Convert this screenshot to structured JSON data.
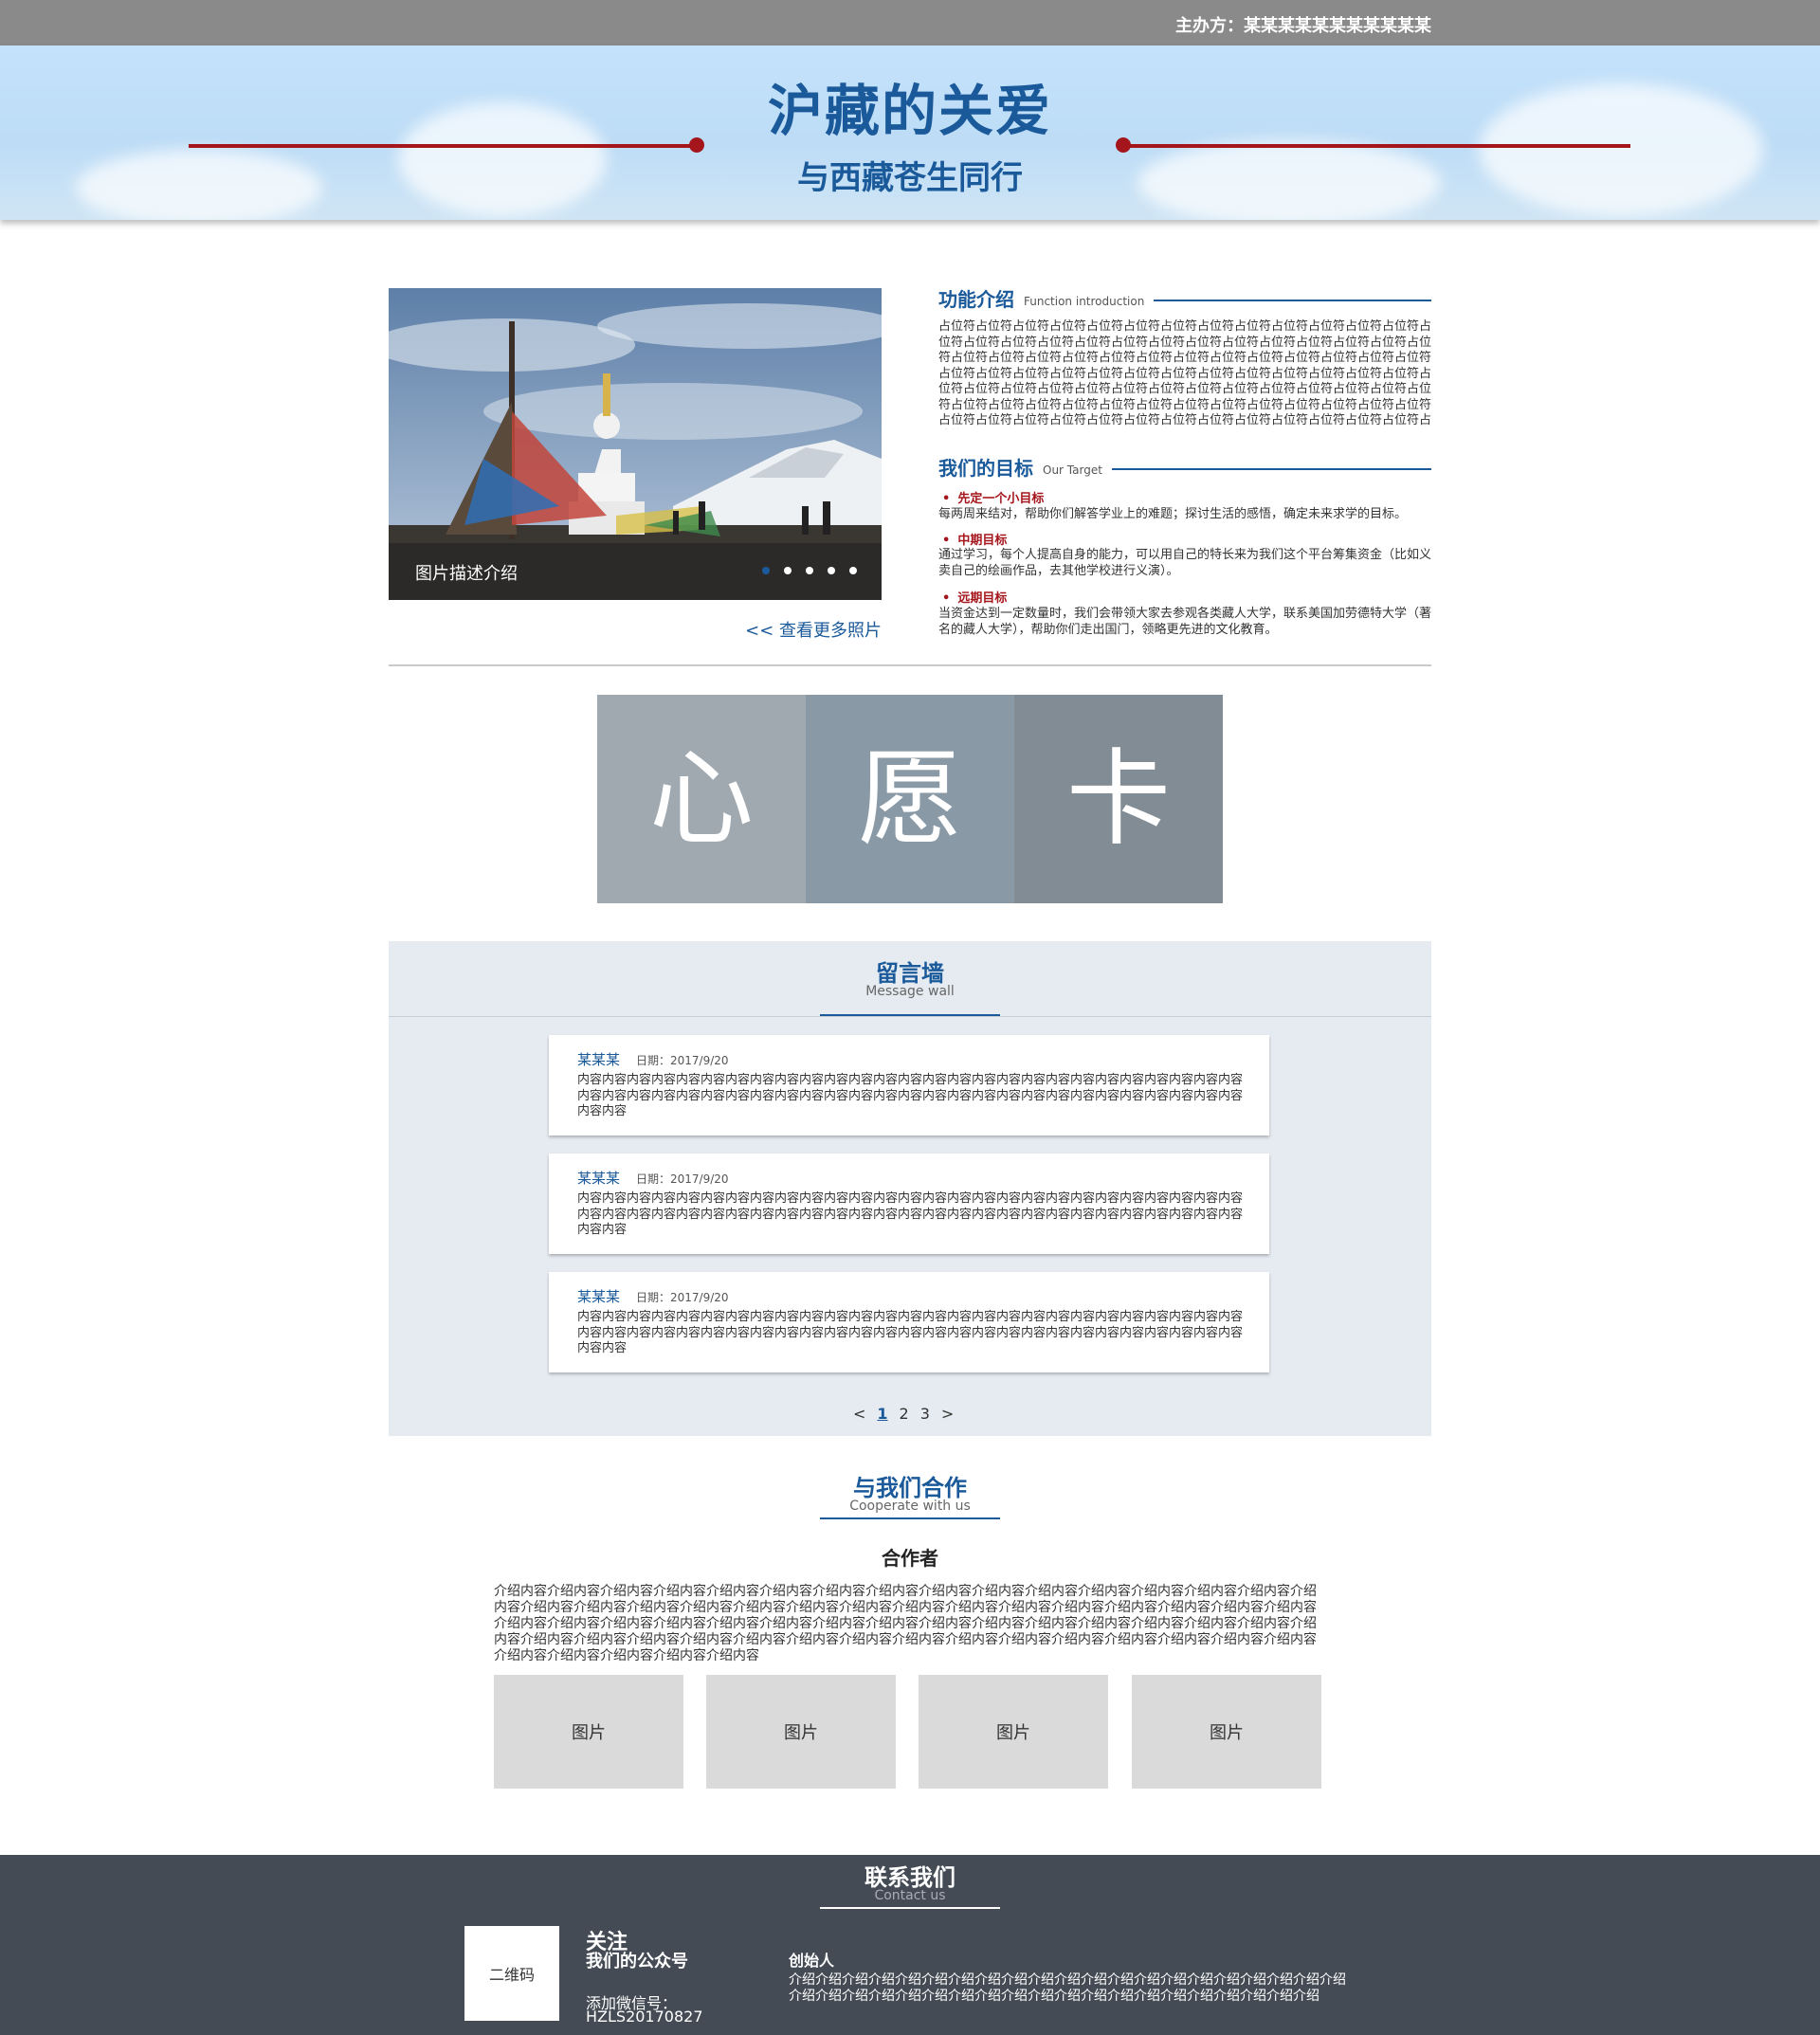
{
  "topbar": {
    "sponsor": "主办方：某某某某某某某某某某某"
  },
  "banner": {
    "title": "沪藏的关爱",
    "subtitle": "与西藏苍生同行"
  },
  "carousel": {
    "caption": "图片描述介绍",
    "more_link": "<< 查看更多照片",
    "slide_count": 5,
    "active_slide": 1
  },
  "function_intro": {
    "title": "功能介绍",
    "subtitle": "Function introduction",
    "body": "占位符占位符占位符占位符占位符占位符占位符占位符占位符占位符占位符占位符占位符占位符占位符占位符占位符占位符占位符占位符占位符占位符占位符占位符占位符占位符占位符占位符占位符占位符占位符占位符占位符占位符占位符占位符占位符占位符占位符占位符占位符占位符占位符占位符占位符占位符占位符占位符占位符占位符占位符占位符占位符占位符占位符占位符占位符占位符占位符占位符占位符占位符占位符占位符占位符占位符占位符占位符占位符占位符占位符占位符占位符占位符占位符占位符占位符占位符占位符占位符占位符占位符占位符占位符占位符占位符占位符占位符占位符占位符占位符占位符占位符占位符"
  },
  "goals": {
    "title": "我们的目标",
    "subtitle": "Our Target",
    "items": [
      {
        "title": "先定一个小目标",
        "body": "每两周来结对，帮助你们解答学业上的难题；探讨生活的感悟，确定未来求学的目标。"
      },
      {
        "title": "中期目标",
        "body": "通过学习，每个人提高自身的能力，可以用自己的特长来为我们这个平台筹集资金（比如义卖自己的绘画作品，去其他学校进行义演）。"
      },
      {
        "title": "远期目标",
        "body": "当资金达到一定数量时，我们会带领大家去参观各类藏人大学，联系美国加劳德特大学（著名的藏人大学），帮助你们走出国门，领略更先进的文化教育。"
      }
    ]
  },
  "wish_card": {
    "chars": [
      "心",
      "愿",
      "卡"
    ],
    "colors": [
      "#a1a9b0",
      "#8999a6",
      "#828c94"
    ]
  },
  "message_wall": {
    "title": "留言墙",
    "subtitle": "Message wall",
    "messages": [
      {
        "author": "某某某",
        "date": "日期：2017/9/20",
        "body": "内容内容内容内容内容内容内容内容内容内容内容内容内容内容内容内容内容内容内容内容内容内容内容内容内容内容内容内容内容内容内容内容内容内容内容内容内容内容内容内容内容内容内容内容内容内容内容内容内容内容内容内容内容内容内容内容"
      },
      {
        "author": "某某某",
        "date": "日期：2017/9/20",
        "body": "内容内容内容内容内容内容内容内容内容内容内容内容内容内容内容内容内容内容内容内容内容内容内容内容内容内容内容内容内容内容内容内容内容内容内容内容内容内容内容内容内容内容内容内容内容内容内容内容内容内容内容内容内容内容内容内容"
      },
      {
        "author": "某某某",
        "date": "日期：2017/9/20",
        "body": "内容内容内容内容内容内容内容内容内容内容内容内容内容内容内容内容内容内容内容内容内容内容内容内容内容内容内容内容内容内容内容内容内容内容内容内容内容内容内容内容内容内容内容内容内容内容内容内容内容内容内容内容内容内容内容内容"
      }
    ],
    "pager": {
      "prev": "<",
      "pages": [
        "1",
        "2",
        "3"
      ],
      "current": "1",
      "next": ">"
    }
  },
  "cooperate": {
    "title": "与我们合作",
    "subtitle": "Cooperate with us",
    "partner_title": "合作者",
    "partner_body": "介绍内容介绍内容介绍内容介绍内容介绍内容介绍内容介绍内容介绍内容介绍内容介绍内容介绍内容介绍内容介绍内容介绍内容介绍内容介绍内容介绍内容介绍内容介绍内容介绍内容介绍内容介绍内容介绍内容介绍内容介绍内容介绍内容介绍内容介绍内容介绍内容介绍内容介绍内容介绍内容介绍内容介绍内容介绍内容介绍内容介绍内容介绍内容介绍内容介绍内容介绍内容介绍内容介绍内容介绍内容介绍内容介绍内容介绍内容介绍内容介绍内容介绍内容介绍内容介绍内容介绍内容介绍内容介绍内容介绍内容介绍内容介绍内容介绍内容介绍内容介绍内容介绍内容介绍内容介绍内容介绍内容介绍内容介绍内容",
    "pictures": [
      "图片",
      "图片",
      "图片",
      "图片"
    ]
  },
  "footer": {
    "title": "联系我们",
    "subtitle": "Contact us",
    "qr_label": "二维码",
    "follow_line1": "关注",
    "follow_line2": "我们的公众号",
    "wechat_label": "添加微信号：",
    "wechat_id": "HZLS20170827",
    "founder_title": "创始人",
    "founder_body": "介绍介绍介绍介绍介绍介绍介绍介绍介绍介绍介绍介绍介绍介绍介绍介绍介绍介绍介绍介绍介绍介绍介绍介绍介绍介绍介绍介绍介绍介绍介绍介绍介绍介绍介绍介绍介绍介绍介绍介绍介绍"
  },
  "colors": {
    "brand_blue": "#1b5a9a",
    "accent_red": "#a5161c",
    "topbar_gray": "#8a8a8a",
    "footer_bg": "#444b54",
    "wall_bg": "#e6ebf1"
  }
}
